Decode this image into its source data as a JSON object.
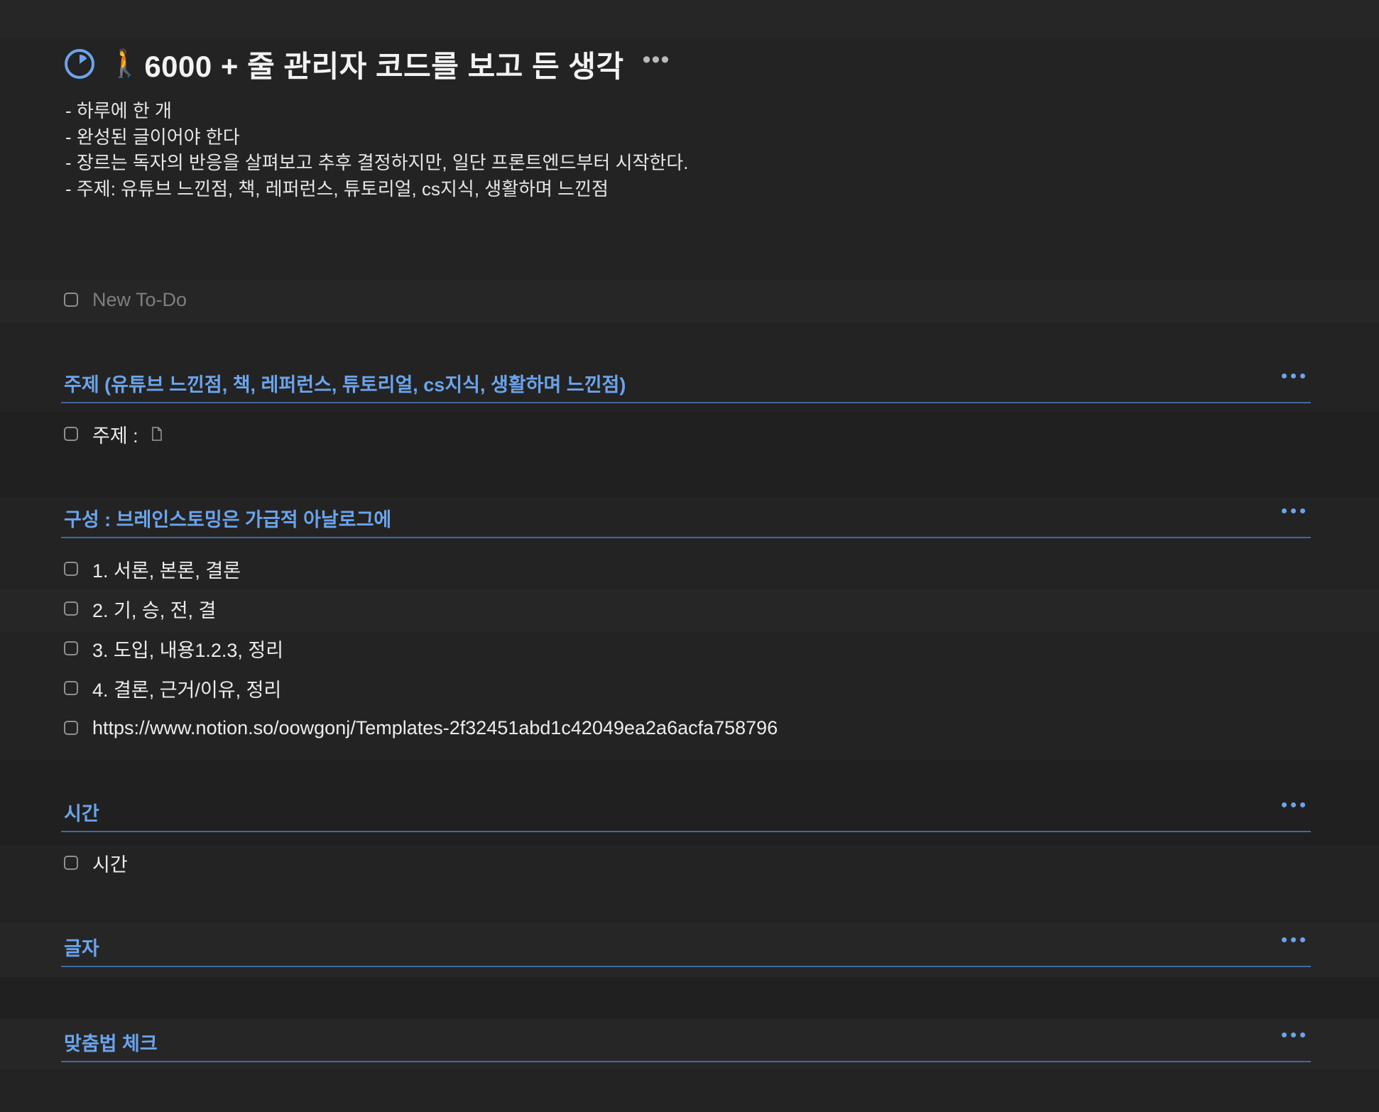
{
  "page": {
    "title_emoji": "🚶",
    "title": "6000 + 줄 관리자 코드를 보고 든 생각",
    "title_more": "•••",
    "notes": [
      "- 하루에 한 개",
      "- 완성된 글이어야 한다",
      "- 장르는 독자의 반응을 살펴보고 추후 결정하지만, 일단 프론트엔드부터 시작한다.",
      "- 주제: 유튜브 느낀점, 책, 레퍼런스, 튜토리얼, cs지식, 생활하며 느낀점"
    ]
  },
  "new_todo": {
    "label": "New To-Do"
  },
  "sections": [
    {
      "heading": "주제 (유튜브 느낀점, 책, 레퍼런스, 튜토리얼, cs지식, 생활하며 느낀점)",
      "items": [
        "주제 :"
      ]
    },
    {
      "heading": "구성 : 브레인스토밍은 가급적 아날로그에",
      "items": [
        "1. 서론, 본론, 결론",
        "2. 기, 승, 전, 결",
        "3. 도입, 내용1.2.3, 정리",
        "4. 결론, 근거/이유, 정리",
        "https://www.notion.so/oowgonj/Templates-2f32451abd1c42049ea2a6acfa758796"
      ]
    },
    {
      "heading": "시간",
      "items": [
        "시간"
      ]
    },
    {
      "heading": "글자",
      "items": []
    },
    {
      "heading": "맞춤법 체크",
      "items": []
    }
  ],
  "colors": {
    "background": "#232323",
    "accent": "#6ba4ec",
    "heading_rule": "#44699e"
  }
}
